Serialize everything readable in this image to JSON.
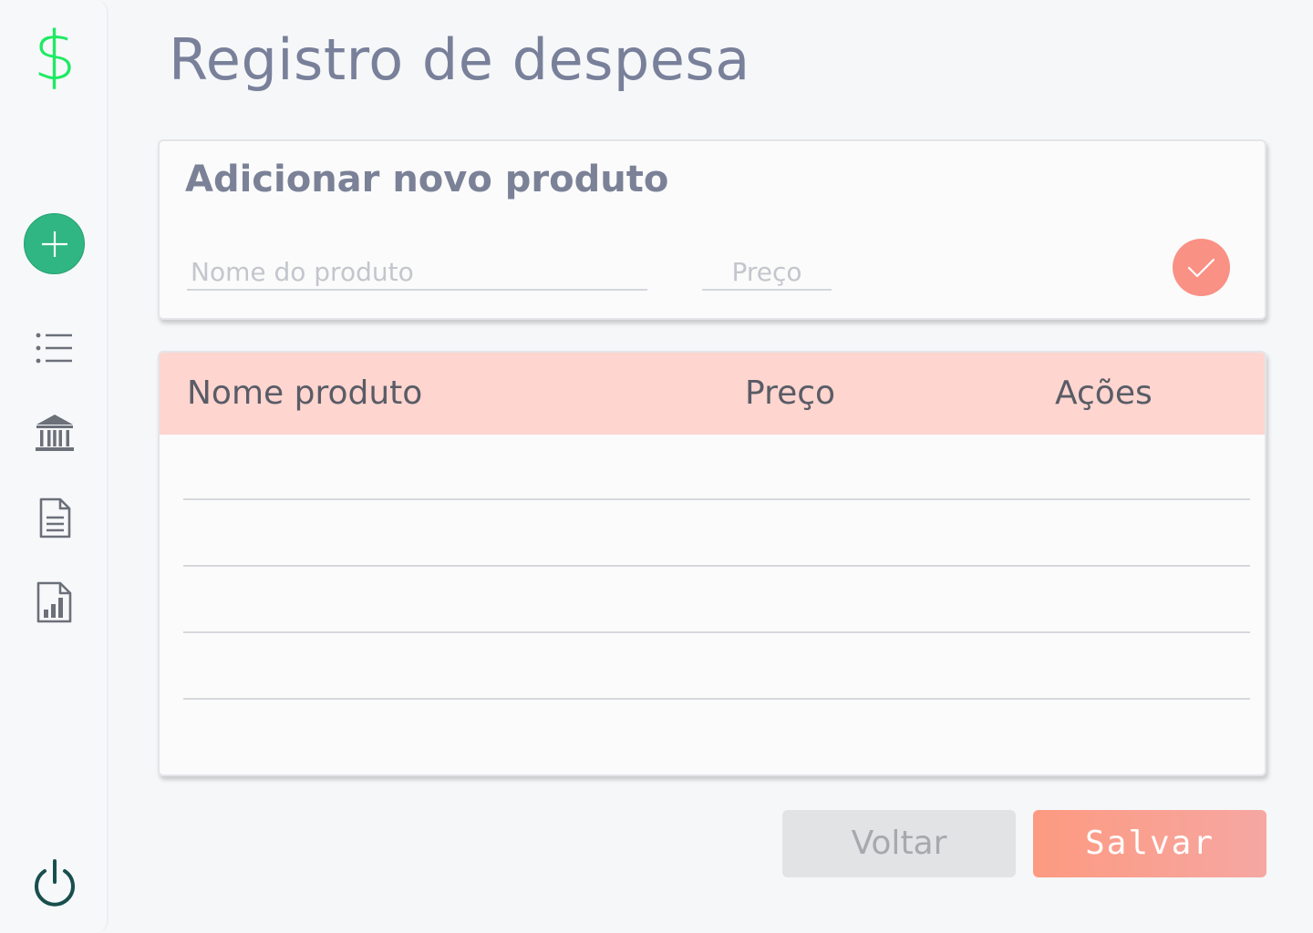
{
  "app": {
    "logo_symbol": "$",
    "colors": {
      "logo": "#1eea63",
      "add_button": "#2fb682",
      "accent": "#f99184",
      "table_header": "#fed5cf"
    }
  },
  "sidebar": {
    "items": [
      {
        "icon": "plus-icon",
        "name": "add"
      },
      {
        "icon": "list-icon",
        "name": "list"
      },
      {
        "icon": "bank-icon",
        "name": "bank"
      },
      {
        "icon": "document-icon",
        "name": "document"
      },
      {
        "icon": "report-icon",
        "name": "report"
      }
    ],
    "footer_icon": "power-icon"
  },
  "page": {
    "title": "Registro de despesa"
  },
  "add_product": {
    "title": "Adicionar novo produto",
    "name_placeholder": "Nome do produto",
    "name_value": "",
    "price_placeholder": "Preço",
    "price_value": "",
    "confirm_icon": "check-icon"
  },
  "table": {
    "columns": [
      "Nome produto",
      "Preço",
      "Ações"
    ],
    "rows": []
  },
  "actions": {
    "back_label": "Voltar",
    "save_label": "Salvar"
  }
}
